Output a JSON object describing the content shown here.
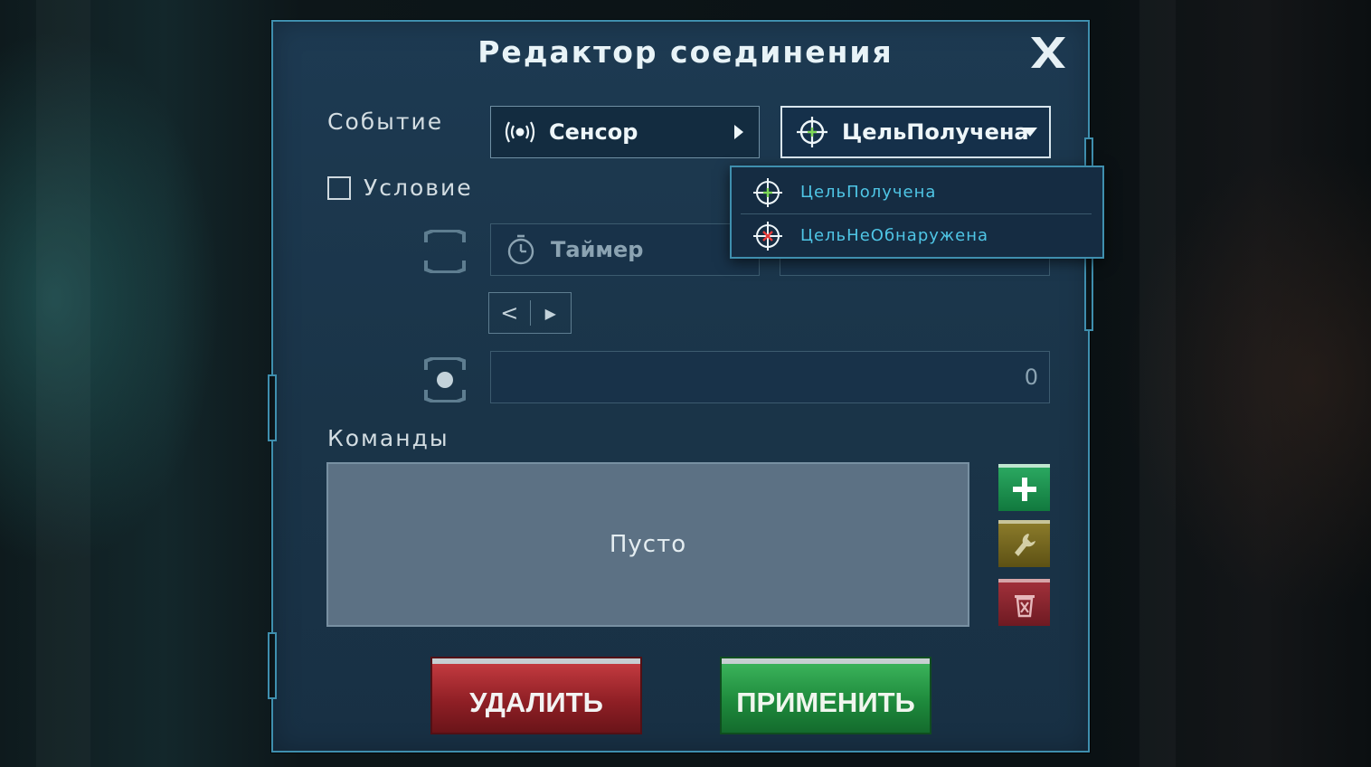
{
  "dialog": {
    "title": "Редактор соединения",
    "close_label": "X"
  },
  "event": {
    "label": "Событие",
    "source": {
      "icon": "sensor-icon",
      "label": "Сенсор"
    },
    "type": {
      "icon": "crosshair-icon",
      "label": "ЦельПолучена"
    }
  },
  "condition": {
    "label": "Условие",
    "checked": false,
    "source": {
      "icon": "stopwatch-icon",
      "label": "Таймер"
    },
    "value": "0"
  },
  "dropdown": {
    "options": [
      {
        "label": "ЦельПолучена",
        "icon": "target-acquired-icon"
      },
      {
        "label": "ЦельНеОбнаружена",
        "icon": "target-lost-icon"
      }
    ]
  },
  "commands": {
    "label": "Команды",
    "empty_text": "Пусто"
  },
  "buttons": {
    "delete_label": "УДАЛИТЬ",
    "apply_label": "ПРИМЕНИТЬ"
  },
  "colors": {
    "panel_border": "#3f8fae",
    "dropdown_text": "#4fc6e6",
    "add": "#1e9a52",
    "edit": "#7a6b22",
    "remove": "#8f262e"
  }
}
